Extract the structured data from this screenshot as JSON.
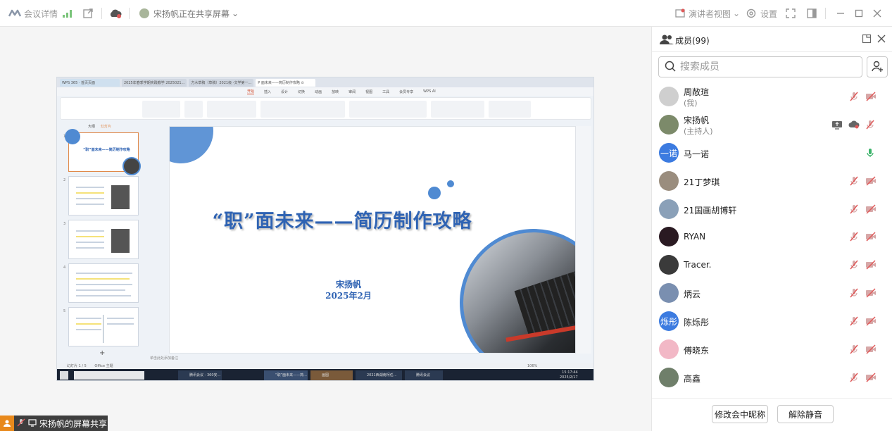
{
  "topbar": {
    "meeting_details": "会议详情",
    "sharer_text": "宋扬帆正在共享屏幕",
    "presenter_view": "演讲者视图",
    "settings": "设置"
  },
  "share": {
    "tabs": [
      "WPS 365 · 首页页面",
      "2025年春季学期实践教学 2025021...",
      "方木草稿（草稿）2021级 -文学第一...",
      "P  面未来——简历制作攻略 ⊙"
    ],
    "menu": [
      "开始",
      "插入",
      "设计",
      "切换",
      "动画",
      "放映",
      "审阅",
      "视图",
      "工具",
      "会员专享",
      "WPS AI"
    ],
    "thumbs_tabs": [
      "大纲",
      "幻灯片"
    ],
    "slide": {
      "title": "“职”面未来——简历制作攻略",
      "author": "宋扬帆",
      "date": "2025年2月"
    },
    "status_left": "幻灯片 1 / 5",
    "status_office": "Office 主题",
    "notes_hint": "单击此处添加备注",
    "zoom": "106%",
    "taskbar_items": [
      "腾讯会议 - 360安...",
      "“职”面未来——简...",
      "画图",
      "2021西湖南柯任...",
      "腾讯会议"
    ],
    "clock_time": "15:17:44",
    "clock_date": "2025/2/17"
  },
  "share_badge": "宋扬帆的屏幕共享",
  "panel": {
    "title": "成员(99)",
    "search_placeholder": "搜索成员",
    "members": [
      {
        "name": "周敞瑄",
        "role": "(我)",
        "avatar_text": "",
        "avatar_color": "#cfcfcf",
        "mic": "muted",
        "cam": "off"
      },
      {
        "name": "宋扬帆",
        "role": "(主持人)",
        "avatar_text": "",
        "avatar_color": "#7c8a6a",
        "mic": "muted",
        "cam": "off",
        "sharing": true
      },
      {
        "name": "马一诺",
        "role": "",
        "avatar_text": "一诺",
        "avatar_color": "#3c7be0",
        "mic": "active",
        "cam": "none"
      },
      {
        "name": "21丁梦琪",
        "role": "",
        "avatar_text": "",
        "avatar_color": "#9a8d7e",
        "mic": "muted",
        "cam": "off"
      },
      {
        "name": "21国画胡博轩",
        "role": "",
        "avatar_text": "",
        "avatar_color": "#8aa0b8",
        "mic": "muted",
        "cam": "off"
      },
      {
        "name": "RYAN",
        "role": "",
        "avatar_text": "",
        "avatar_color": "#2a1a22",
        "mic": "muted",
        "cam": "off"
      },
      {
        "name": "Tracer.",
        "role": "",
        "avatar_text": "",
        "avatar_color": "#3a3a3a",
        "mic": "muted",
        "cam": "off"
      },
      {
        "name": "炳云",
        "role": "",
        "avatar_text": "",
        "avatar_color": "#7a8fb0",
        "mic": "muted",
        "cam": "off"
      },
      {
        "name": "陈烁彤",
        "role": "",
        "avatar_text": "烁彤",
        "avatar_color": "#3c7be0",
        "mic": "muted",
        "cam": "off"
      },
      {
        "name": "傅晓东",
        "role": "",
        "avatar_text": "",
        "avatar_color": "#f2b8c6",
        "mic": "muted",
        "cam": "off"
      },
      {
        "name": "高鑫",
        "role": "",
        "avatar_text": "",
        "avatar_color": "#6f7f6a",
        "mic": "muted",
        "cam": "off"
      }
    ],
    "rename_button": "修改会中昵称",
    "unmute_button": "解除静音"
  },
  "colors": {
    "accent_blue": "#2f63b3",
    "muted_red": "#e05a5a",
    "active_green": "#3bb36a",
    "share_orange": "#e8891c"
  }
}
